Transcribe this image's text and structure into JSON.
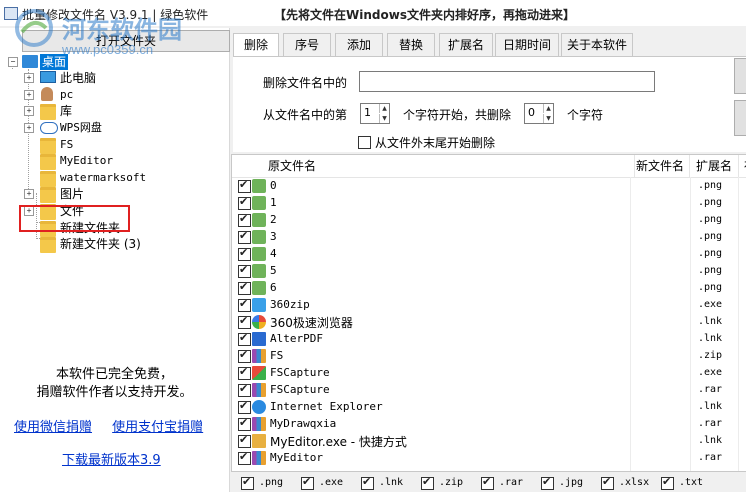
{
  "window": {
    "title": "批量修改文件名 V3.9.1 | 绿色软件",
    "hint": "【先将文件在Windows文件夹内排好序，再拖动进来】"
  },
  "watermark": {
    "text": "河东软件园",
    "url": "www.pc0359.cn"
  },
  "left": {
    "open_folder_label": "打开文件夹",
    "tree": [
      {
        "label": "桌面",
        "selected": true
      },
      {
        "label": "此电脑"
      },
      {
        "label": "pc"
      },
      {
        "label": "库"
      },
      {
        "label": "WPS网盘"
      },
      {
        "label": "FS"
      },
      {
        "label": "MyEditor"
      },
      {
        "label": "watermarksoft"
      },
      {
        "label": "图片"
      },
      {
        "label": "文件"
      },
      {
        "label": "新建文件夹"
      },
      {
        "label": "新建文件夹 (3)"
      }
    ],
    "free_note_line1": "本软件已完全免费，",
    "free_note_line2": "捐赠软件作者以支持开发。",
    "donate_wechat": "使用微信捐赠",
    "donate_alipay": "使用支付宝捐赠",
    "download_latest": "下载最新版本3.9"
  },
  "tabs": [
    "删除",
    "序号",
    "添加",
    "替换",
    "扩展名",
    "日期时间",
    "关于本软件"
  ],
  "delete_tab": {
    "delete_in_name_label": "删除文件名中的",
    "delete_in_name_value": "",
    "from_position_prefix": "从文件名中的第",
    "start_value": "1",
    "middle_label": "个字符开始，共删除",
    "count_value": "0",
    "suffix_label": "个字符",
    "from_end_label": "从文件外末尾开始删除",
    "from_end_checked": false
  },
  "list": {
    "headers": [
      "原文件名",
      "新文件名",
      "扩展名",
      "存"
    ],
    "rows": [
      {
        "name": "0",
        "ext": ".png",
        "icon": "png-icon",
        "checked": true
      },
      {
        "name": "1",
        "ext": ".png",
        "icon": "png-icon",
        "checked": true
      },
      {
        "name": "2",
        "ext": ".png",
        "icon": "png-icon",
        "checked": true
      },
      {
        "name": "3",
        "ext": ".png",
        "icon": "png-icon",
        "checked": true
      },
      {
        "name": "4",
        "ext": ".png",
        "icon": "png-icon",
        "checked": true
      },
      {
        "name": "5",
        "ext": ".png",
        "icon": "png-icon",
        "checked": true
      },
      {
        "name": "6",
        "ext": ".png",
        "icon": "png-icon",
        "checked": true
      },
      {
        "name": "360zip",
        "ext": ".exe",
        "icon": "zip-app-icon",
        "checked": true
      },
      {
        "name": "360极速浏览器",
        "ext": ".lnk",
        "icon": "browser-icon",
        "checked": true
      },
      {
        "name": "AlterPDF",
        "ext": ".lnk",
        "icon": "pdf-icon",
        "checked": true
      },
      {
        "name": "FS",
        "ext": ".zip",
        "icon": "archive-icon",
        "checked": true
      },
      {
        "name": "FSCapture",
        "ext": ".exe",
        "icon": "capture-icon",
        "checked": true
      },
      {
        "name": "FSCapture",
        "ext": ".rar",
        "icon": "archive-icon",
        "checked": true
      },
      {
        "name": "Internet Explorer",
        "ext": ".lnk",
        "icon": "ie-icon",
        "checked": true
      },
      {
        "name": "MyDrawqxia",
        "ext": ".rar",
        "icon": "archive-icon",
        "checked": true
      },
      {
        "name": "MyEditor.exe - 快捷方式",
        "ext": ".lnk",
        "icon": "editor-icon",
        "checked": true
      },
      {
        "name": "MyEditor",
        "ext": ".rar",
        "icon": "archive-icon",
        "checked": true
      }
    ]
  },
  "filters": [
    ".png",
    ".exe",
    ".lnk",
    ".zip",
    ".rar",
    ".jpg",
    ".xlsx",
    ".txt"
  ],
  "colors": {
    "link": "#0033cc",
    "highlight": "#e02020",
    "folder": "#f4c84a"
  }
}
